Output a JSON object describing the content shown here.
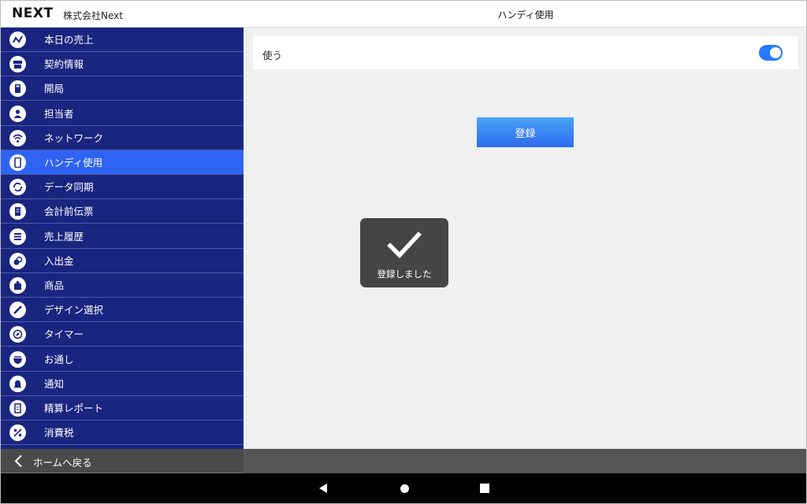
{
  "header": {
    "logo": "NEXT",
    "company": "株式会社Next",
    "page_title": "ハンディ使用"
  },
  "sidebar": {
    "active_index": 5,
    "items": [
      {
        "label": "本日の売上",
        "icon": "sales-trend-icon"
      },
      {
        "label": "契約情報",
        "icon": "store-icon"
      },
      {
        "label": "開局",
        "icon": "calculator-icon"
      },
      {
        "label": "担当者",
        "icon": "person-icon"
      },
      {
        "label": "ネットワーク",
        "icon": "wifi-icon"
      },
      {
        "label": "ハンディ使用",
        "icon": "handheld-device-icon"
      },
      {
        "label": "データ同期",
        "icon": "sync-icon"
      },
      {
        "label": "会計前伝票",
        "icon": "receipt-icon"
      },
      {
        "label": "売上履歴",
        "icon": "list-icon"
      },
      {
        "label": "入出金",
        "icon": "coins-icon"
      },
      {
        "label": "商品",
        "icon": "product-icon"
      },
      {
        "label": "デザイン選択",
        "icon": "pen-icon"
      },
      {
        "label": "タイマー",
        "icon": "compass-icon"
      },
      {
        "label": "お通し",
        "icon": "bowl-icon"
      },
      {
        "label": "通知",
        "icon": "bell-icon"
      },
      {
        "label": "精算レポート",
        "icon": "report-icon"
      },
      {
        "label": "消費税",
        "icon": "percent-icon"
      }
    ]
  },
  "main": {
    "setting_label": "使う",
    "toggle_on": true,
    "register_label": "登録",
    "toast_text": "登録しました"
  },
  "footer": {
    "back_label": "ホームへ戻る"
  },
  "colors": {
    "sidebar_bg": "#1a2580",
    "active_item": "#2f63f4",
    "toggle_on": "#2979ff",
    "button_top": "#4aa3f7",
    "button_bottom": "#2f6bef",
    "toast_bg": "#454545"
  }
}
